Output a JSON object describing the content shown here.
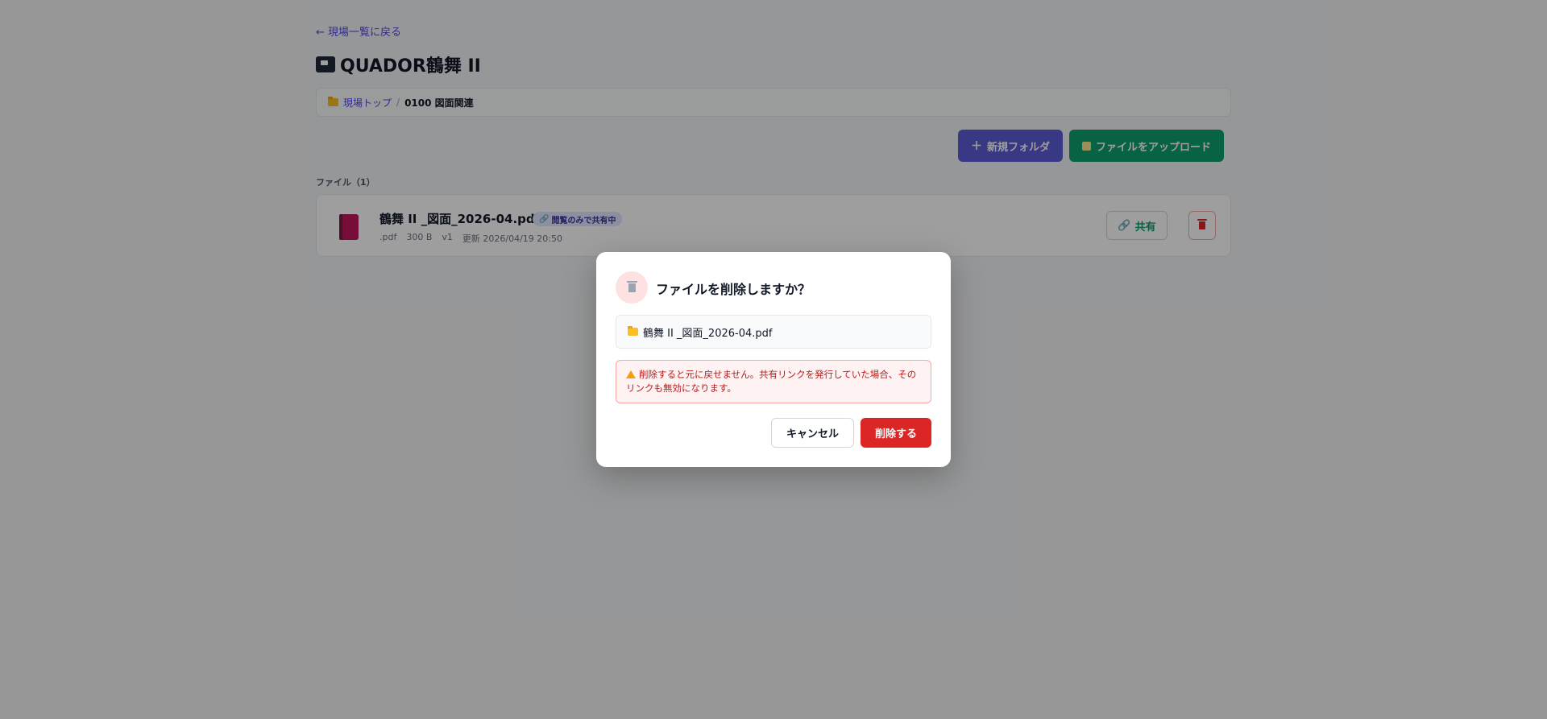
{
  "nav": {
    "back_label": "← 現場一覧に戻る"
  },
  "site": {
    "title": "QUADOR鶴舞 II"
  },
  "breadcrumb": {
    "root": "現場トップ",
    "separator": "/",
    "current": "0100 図面関連"
  },
  "toolbar": {
    "new_folder_label": "新規フォルダ",
    "upload_label": "ファイルをアップロード"
  },
  "files": {
    "heading": "ファイル（1）",
    "items": [
      {
        "name": "鶴舞 II _図面_2026-04.pdf",
        "badge": "閲覧のみで共有中",
        "ext": ".pdf",
        "size": "300 B",
        "version": "v1",
        "updated": "更新 2026/04/19 20:50",
        "share_label": "共有"
      }
    ]
  },
  "modal": {
    "title": "ファイルを削除しますか？",
    "file_name": "鶴舞 II _図面_2026-04.pdf",
    "warning": "削除すると元に戻せません。共有リンクを発行していた場合、そのリンクも無効になります。",
    "cancel_label": "キャンセル",
    "delete_label": "削除する"
  },
  "colors": {
    "accent": "#5b5bd6",
    "success": "#0e9f6e",
    "danger": "#dc2626"
  }
}
